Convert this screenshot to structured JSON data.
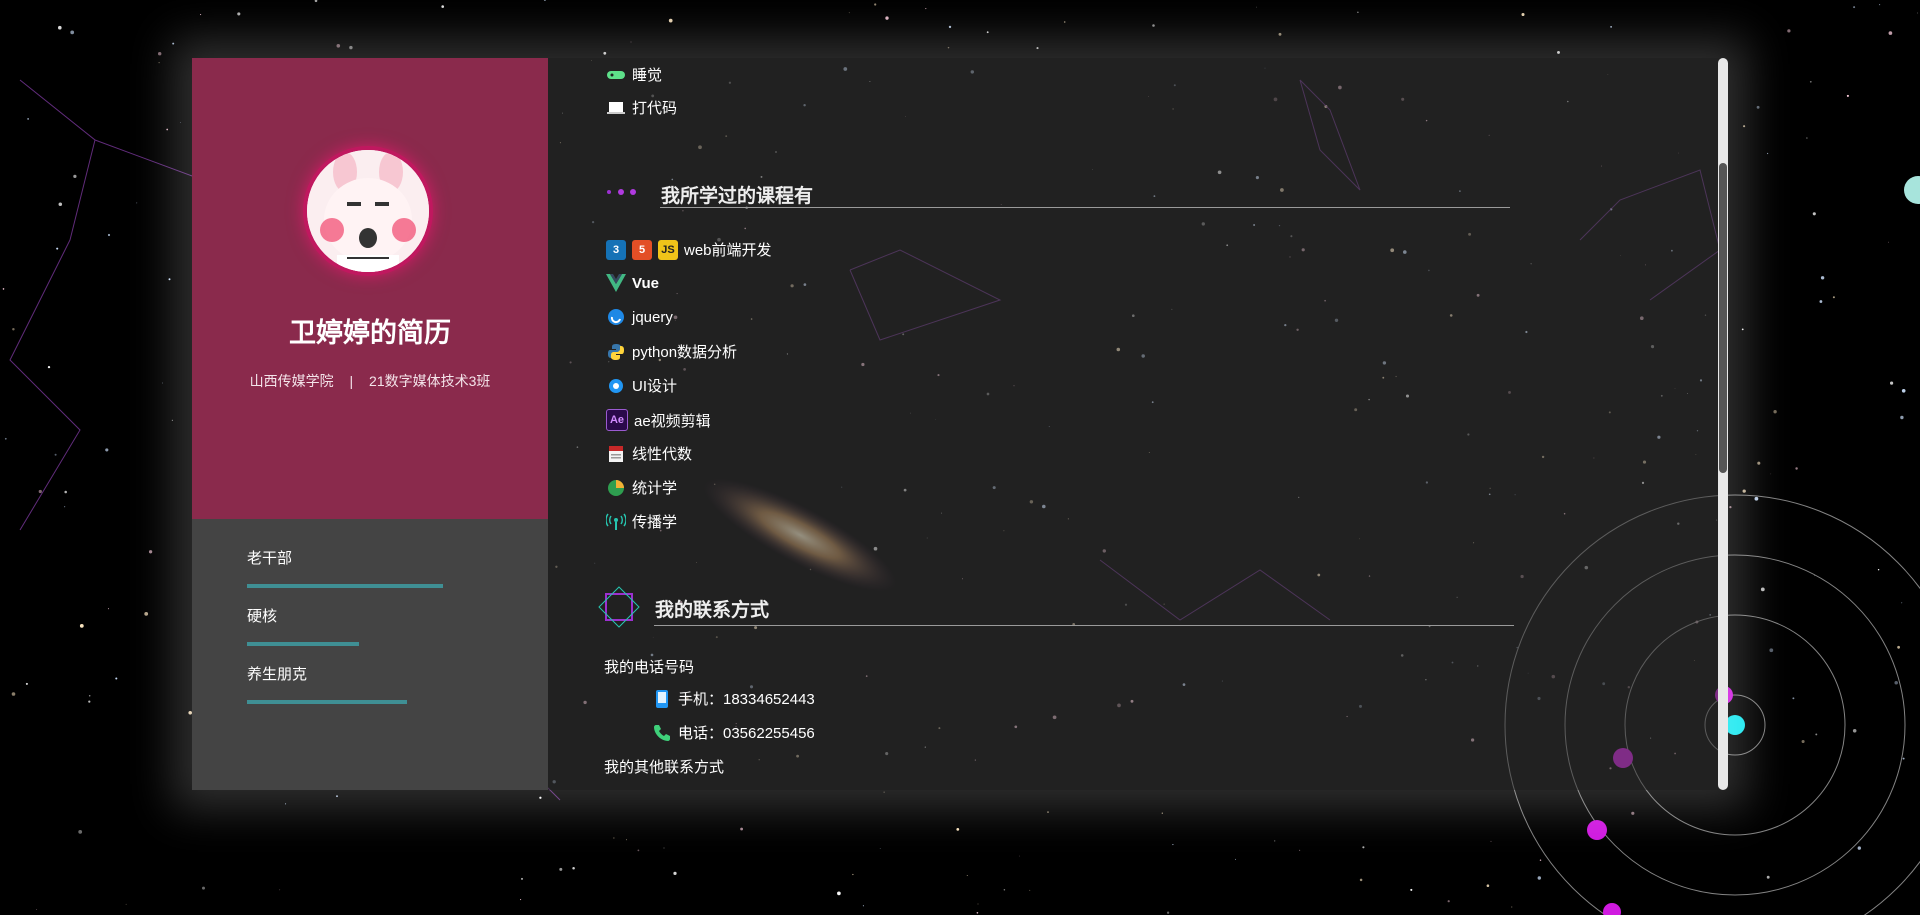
{
  "profile": {
    "name": "卫婷婷的简历",
    "school": "山西传媒学院",
    "separator": "|",
    "class": "21数字媒体技术3班"
  },
  "tags": [
    {
      "label": "老干部",
      "level": 0.7
    },
    {
      "label": "硬核",
      "level": 0.4
    },
    {
      "label": "养生朋克",
      "level": 0.57
    }
  ],
  "hobbies": [
    {
      "label": "睡觉",
      "icon": "gamepad-icon"
    },
    {
      "label": "打代码",
      "icon": "laptop-icon"
    }
  ],
  "courses": {
    "title": "我所学过的课程有",
    "items": [
      {
        "label": "web前端开发",
        "icons": [
          "css3-icon",
          "html5-icon",
          "js-icon"
        ]
      },
      {
        "label": "Vue",
        "icons": [
          "vue-icon"
        ]
      },
      {
        "label": "jquery",
        "icons": [
          "jquery-icon"
        ]
      },
      {
        "label": "python数据分析",
        "icons": [
          "python-icon"
        ]
      },
      {
        "label": "UI设计",
        "icons": [
          "ui-icon"
        ]
      },
      {
        "label": "ae视频剪辑",
        "icons": [
          "ae-icon"
        ]
      },
      {
        "label": "线性代数",
        "icons": [
          "book-icon"
        ]
      },
      {
        "label": "统计学",
        "icons": [
          "pie-chart-icon"
        ]
      },
      {
        "label": "传播学",
        "icons": [
          "broadcast-icon"
        ]
      }
    ]
  },
  "contact": {
    "title": "我的联系方式",
    "phone_heading": "我的电话号码",
    "mobile": "手机：18334652443",
    "telephone": "电话：03562255456",
    "other_heading": "我的其他联系方式"
  },
  "icon_text": {
    "js": "JS",
    "ae": "Ae",
    "css": "3",
    "html": "5"
  }
}
